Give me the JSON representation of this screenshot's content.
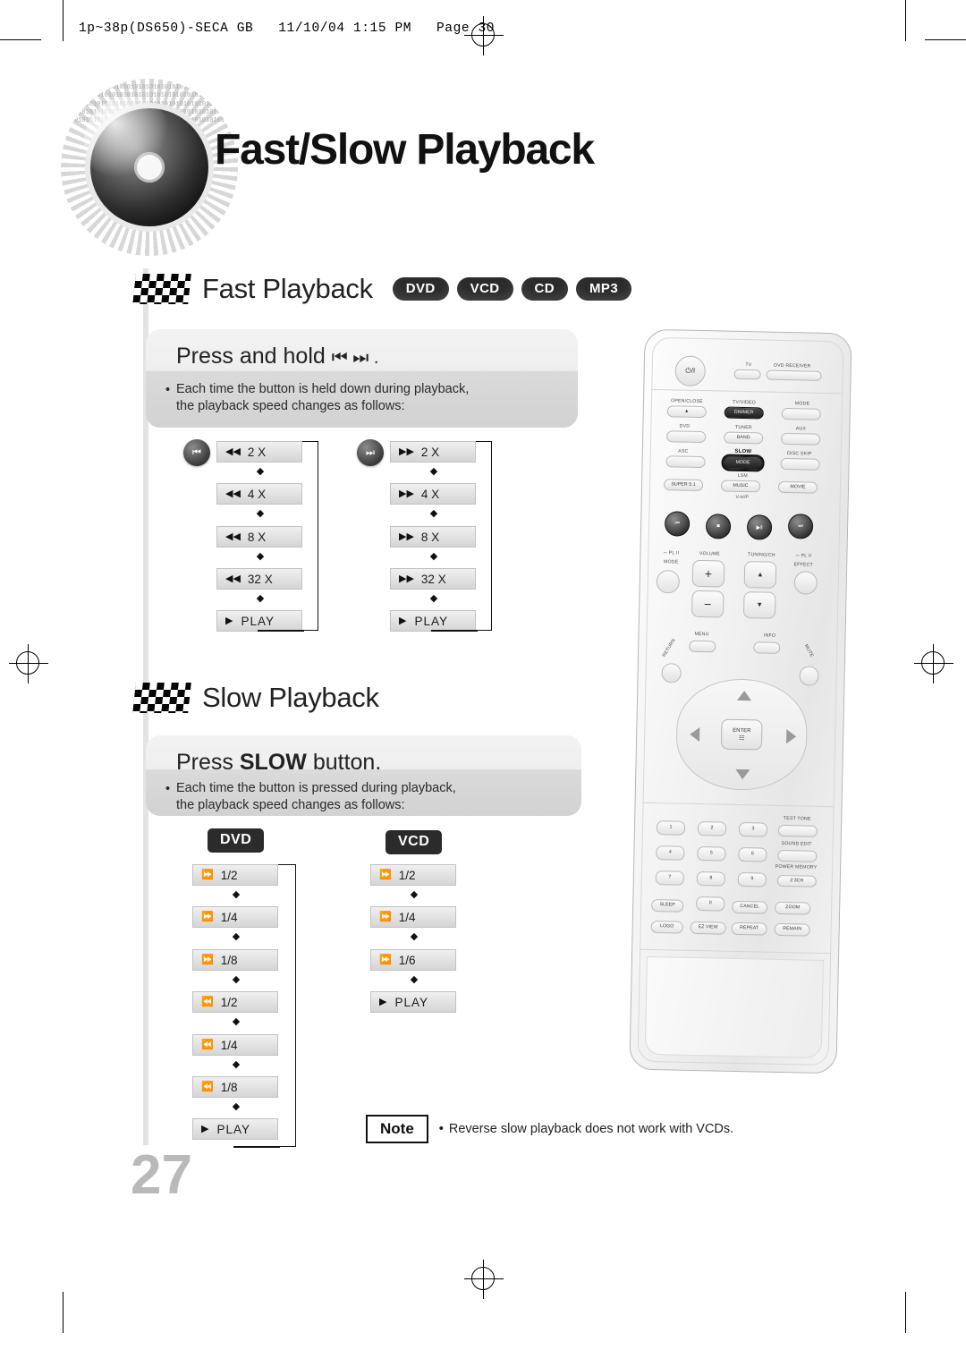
{
  "header": {
    "file_line": "1p~38p(DS650)-SECA GB   11/10/04 1:15 PM   Page 30"
  },
  "page": {
    "title": "Fast/Slow Playback",
    "number": "27"
  },
  "sections": [
    {
      "id": "fast",
      "title": "Fast Playback",
      "badges": [
        "DVD",
        "VCD",
        "CD",
        "MP3"
      ],
      "panel": {
        "instruction_prefix": "Press and hold",
        "instruction_icons": "⏮  ⏭ .",
        "bullet_line1": "Each time the button is held down during playback,",
        "bullet_line2": "the playback speed changes as follows:"
      },
      "columns": [
        {
          "button_icon": "⏮",
          "direction_glyph": "◀◀",
          "steps": [
            "2 X",
            "4 X",
            "8 X",
            "32 X"
          ],
          "end_label": "PLAY"
        },
        {
          "button_icon": "⏭",
          "direction_glyph": "▶▶",
          "steps": [
            "2 X",
            "4 X",
            "8 X",
            "32 X"
          ],
          "end_label": "PLAY"
        }
      ]
    },
    {
      "id": "slow",
      "title": "Slow Playback",
      "badges": [],
      "panel": {
        "instruction_prefix": "Press",
        "instruction_strong": "SLOW",
        "instruction_suffix": "button.",
        "bullet_line1": "Each time the button is pressed during playback,",
        "bullet_line2": "the playback speed changes as follows:"
      },
      "columns": [
        {
          "tag": "DVD",
          "steps": [
            {
              "glyph": "⏩",
              "label": "1/2"
            },
            {
              "glyph": "⏩",
              "label": "1/4"
            },
            {
              "glyph": "⏩",
              "label": "1/8"
            },
            {
              "glyph": "⏪",
              "label": "1/2"
            },
            {
              "glyph": "⏪",
              "label": "1/4"
            },
            {
              "glyph": "⏪",
              "label": "1/8"
            }
          ],
          "end_label": "PLAY"
        },
        {
          "tag": "VCD",
          "steps": [
            {
              "glyph": "⏩",
              "label": "1/2"
            },
            {
              "glyph": "⏩",
              "label": "1/4"
            },
            {
              "glyph": "⏩",
              "label": "1/6"
            }
          ],
          "end_label": "PLAY"
        }
      ]
    }
  ],
  "note": {
    "label": "Note",
    "bullet": "•",
    "text": "Reverse slow playback does not work with VCDs."
  },
  "remote": {
    "top_labels": {
      "tv": "TV",
      "receiver": "DVD RECEIVER"
    },
    "power_icon": "⏻/I",
    "rows": [
      {
        "keys": [
          "OPEN/CLOSE",
          "TV/VIDEO",
          "MODE"
        ]
      },
      {
        "keys": [
          "DVD",
          "TUNER",
          "AUX"
        ]
      },
      {
        "keys": [
          "ASC",
          "SLOW",
          "DISC SKIP"
        ]
      },
      {
        "keys": [
          "SUPER 5.1",
          "MUSIC",
          "MOVIE"
        ]
      }
    ],
    "sub_labels": {
      "dimmer": "DIMMER",
      "band": "BAND",
      "mode": "MODE",
      "lsm": "LSM",
      "vhp": "V-H/P"
    },
    "transport": [
      "⏮",
      "■",
      "▶‖",
      "⏭"
    ],
    "mid_labels": {
      "volume": "VOLUME",
      "tuning": "TUNING/CH",
      "pl_mode": "MODE",
      "pl_effect": "EFFECT",
      "dpl": "⎓ PL II"
    },
    "nav_labels": {
      "menu": "MENU",
      "info": "INFO",
      "return": "RETURN",
      "mute": "MUTE",
      "enter": "ENTER"
    },
    "numpad": [
      "1",
      "2",
      "3",
      "4",
      "5",
      "6",
      "7",
      "8",
      "9",
      "0"
    ],
    "right_labels": [
      "TEST TONE",
      "SOUND EDIT",
      "POWER MEMORY",
      "2:3CH"
    ],
    "bottom_keys": [
      "SLEEP",
      "CANCEL",
      "ZOOM",
      "LOGO",
      "EZ VIEW",
      "REPEAT",
      "REMAIN"
    ]
  }
}
